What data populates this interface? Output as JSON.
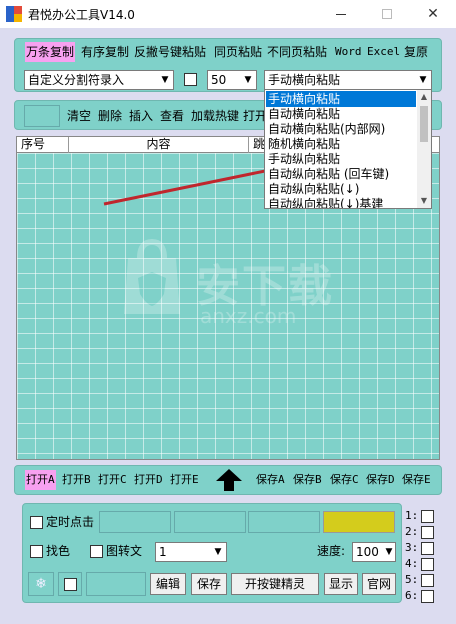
{
  "window": {
    "title": "君悦办公工具V14.0"
  },
  "toolbar1": {
    "buttons": [
      "万条复制",
      "有序复制",
      "反撇号键粘贴",
      "同页粘贴",
      "不同页粘贴",
      "Word",
      "Excel",
      "复原"
    ],
    "split_select": "自定义分割符录入",
    "count_select": "50",
    "mode_select": "手动横向粘贴"
  },
  "dropdown": {
    "options": [
      "手动横向粘贴",
      "自动横向粘贴",
      "自动横向粘贴(内部网)",
      "随机横向粘贴",
      "手动纵向粘贴",
      "自动纵向粘贴 (回车键)",
      "自动纵向粘贴(↓)",
      "自动纵向粘贴(↓)基建"
    ]
  },
  "toolbar2": {
    "buttons": [
      "清空",
      "删除",
      "插入",
      "查看",
      "加载热键",
      "打开"
    ]
  },
  "grid": {
    "headers": [
      "序号",
      "内容",
      "跳"
    ]
  },
  "watermark": {
    "text": "安下载",
    "sub": "anxz.com"
  },
  "toolbar3": {
    "open_buttons": [
      "打开A",
      "打开B",
      "打开C",
      "打开D",
      "打开E"
    ],
    "save_buttons": [
      "保存A",
      "保存B",
      "保存C",
      "保存D",
      "保存E"
    ]
  },
  "bottom": {
    "timer_label": "定时点击",
    "find_color_label": "找色",
    "img2text_label": "图转文",
    "combo_value": "1",
    "speed_label": "速度:",
    "speed_value": "100",
    "buttons": [
      "编辑",
      "保存",
      "开按键精灵",
      "显示",
      "官网"
    ],
    "slots": [
      "1:",
      "2:",
      "3:",
      "4:",
      "5:",
      "6:"
    ]
  },
  "colors": {
    "panel": "#7fd1c9",
    "background": "#dcdcf0",
    "active_button": "#f7a1f0",
    "selection": "#0078d7",
    "yellow_box": "#d4cc1c",
    "arrow": "#c0262d"
  }
}
